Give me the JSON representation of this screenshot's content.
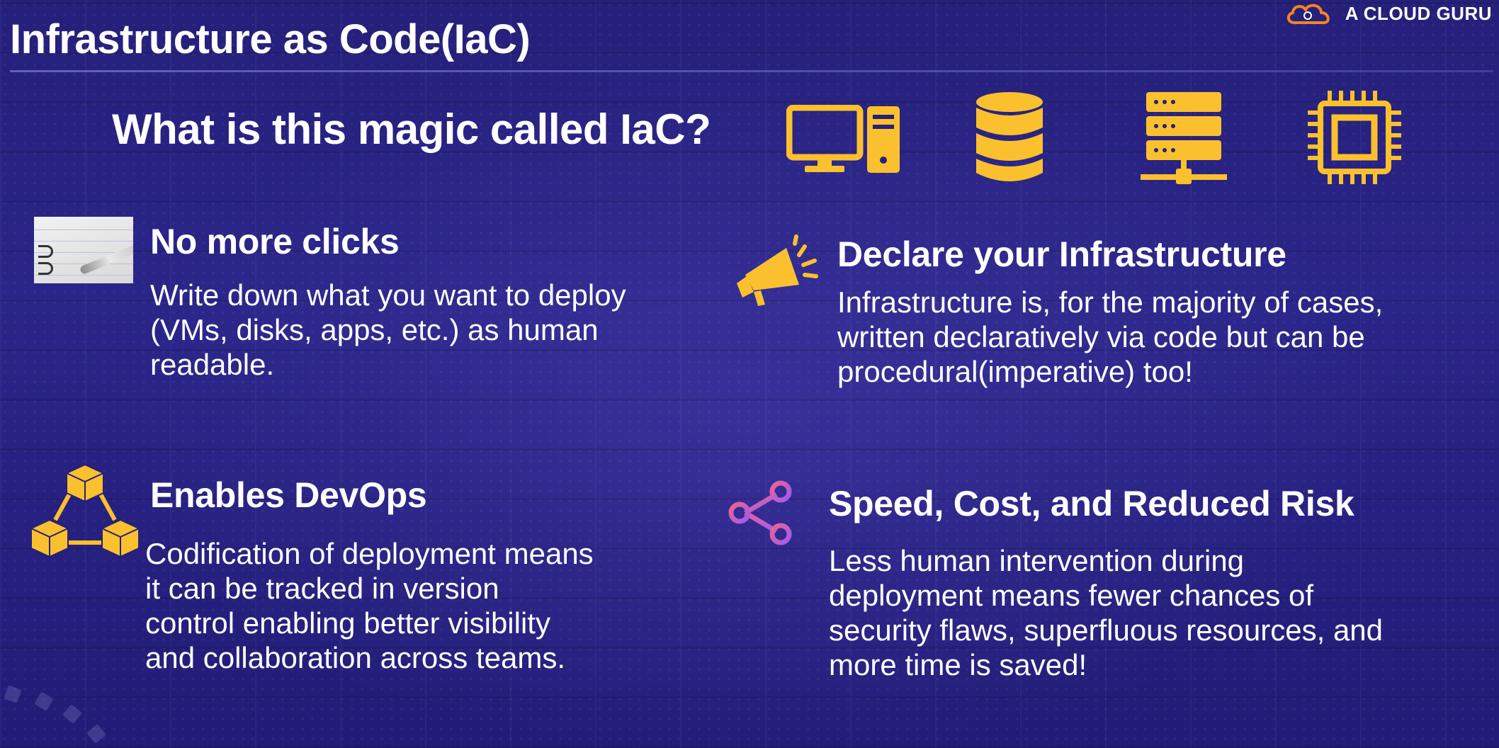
{
  "header": {
    "title": "Infrastructure as Code(IaC)",
    "brand": "A CLOUD GURU"
  },
  "question": "What is this magic called IaC?",
  "top_icons": [
    "desktop-computer-icon",
    "database-icon",
    "server-network-icon",
    "cpu-chip-icon"
  ],
  "sections": {
    "no_clicks": {
      "heading": "No more clicks",
      "lines": [
        "Write down what you want to deploy",
        "(VMs, disks, apps, etc.) as human",
        "readable."
      ]
    },
    "declare": {
      "heading": "Declare your Infrastructure",
      "lines": [
        "Infrastructure is, for the majority of cases,",
        "written declaratively via code but can be",
        "procedural(imperative) too!"
      ]
    },
    "devops": {
      "heading": "Enables DevOps",
      "lines": [
        "Codification of deployment means",
        "it can be tracked in version",
        "control enabling better visibility",
        "and collaboration across teams."
      ]
    },
    "speed": {
      "heading": "Speed, Cost, and Reduced Risk",
      "lines": [
        "Less human intervention during",
        "deployment means fewer chances of",
        "security flaws, superfluous resources, and",
        "more time is saved!"
      ]
    }
  },
  "colors": {
    "accent_yellow": "#fbc02d",
    "brand_orange": "#f58220",
    "share_pink": "#f06292",
    "share_purple": "#9c5cf0",
    "background": "#25207a"
  }
}
